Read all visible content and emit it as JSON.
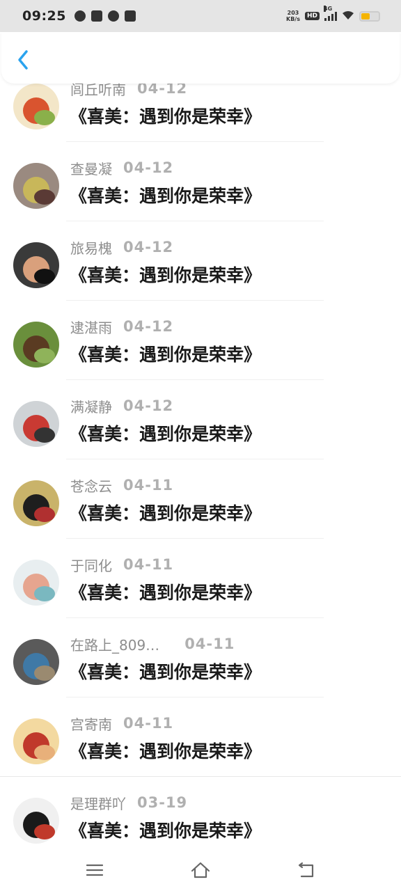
{
  "status_bar": {
    "time": "09:25",
    "net_speed_value": "203",
    "net_speed_unit": "KB/s",
    "hd": "HD",
    "network": "4G",
    "battery_color": "#f5b400"
  },
  "header": {
    "back_icon": "chevron-left-icon",
    "accent_color": "#2aa3ee"
  },
  "comments": [
    {
      "name": "闾丘听南",
      "date": "04-12",
      "title": "《喜美：遇到你是荣幸》",
      "avatar_colors": [
        "#f3e6c8",
        "#d9542f",
        "#8ab04a"
      ]
    },
    {
      "name": "查曼凝",
      "date": "04-12",
      "title": "《喜美：遇到你是荣幸》",
      "avatar_colors": [
        "#9a8a80",
        "#c8b75a",
        "#5a3a35"
      ]
    },
    {
      "name": "旅易槐",
      "date": "04-12",
      "title": "《喜美：遇到你是荣幸》",
      "avatar_colors": [
        "#3a3a3a",
        "#d9a07c",
        "#111111"
      ]
    },
    {
      "name": "逮湛雨",
      "date": "04-12",
      "title": "《喜美：遇到你是荣幸》",
      "avatar_colors": [
        "#6a8f3c",
        "#5a3b22",
        "#8fb35a"
      ]
    },
    {
      "name": "满凝静",
      "date": "04-12",
      "title": "《喜美：遇到你是荣幸》",
      "avatar_colors": [
        "#cfd3d6",
        "#c93a33",
        "#333333"
      ]
    },
    {
      "name": "苍念云",
      "date": "04-11",
      "title": "《喜美：遇到你是荣幸》",
      "avatar_colors": [
        "#c9b36a",
        "#1e1e1e",
        "#b03030"
      ]
    },
    {
      "name": "于同化",
      "date": "04-11",
      "title": "《喜美：遇到你是荣幸》",
      "avatar_colors": [
        "#e8eef0",
        "#e6a58f",
        "#7ab8c0"
      ]
    },
    {
      "name": "在路上_809…",
      "date": "04-11",
      "title": "《喜美：遇到你是荣幸》",
      "avatar_colors": [
        "#5a5a5a",
        "#3f79a6",
        "#9a8a70"
      ]
    },
    {
      "name": "宫寄南",
      "date": "04-11",
      "title": "《喜美：遇到你是荣幸》",
      "avatar_colors": [
        "#f3d9a0",
        "#c0392b",
        "#e8b07a"
      ]
    },
    {
      "name": "是理群吖",
      "date": "03-19",
      "title": "《喜美：遇到你是荣幸》",
      "avatar_colors": [
        "#f0f0f0",
        "#1a1a1a",
        "#c0392b"
      ]
    }
  ],
  "nav_bar": {
    "menu_icon": "menu-icon",
    "home_icon": "home-icon",
    "back_icon": "back-icon"
  }
}
